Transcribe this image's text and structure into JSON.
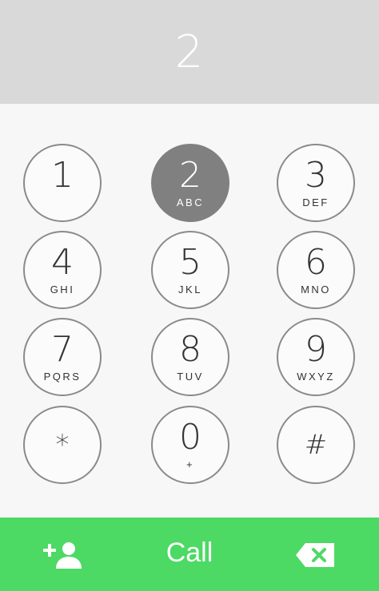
{
  "display": {
    "value": "2"
  },
  "keypad": {
    "keys": [
      {
        "digit": "1",
        "letters": ""
      },
      {
        "digit": "2",
        "letters": "ABC"
      },
      {
        "digit": "3",
        "letters": "DEF"
      },
      {
        "digit": "4",
        "letters": "GHI"
      },
      {
        "digit": "5",
        "letters": "JKL"
      },
      {
        "digit": "6",
        "letters": "MNO"
      },
      {
        "digit": "7",
        "letters": "PQRS"
      },
      {
        "digit": "8",
        "letters": "TUV"
      },
      {
        "digit": "9",
        "letters": "WXYZ"
      },
      {
        "digit": "*",
        "letters": ""
      },
      {
        "digit": "0",
        "letters": "+"
      },
      {
        "digit": "#",
        "letters": ""
      }
    ],
    "active_key": "2"
  },
  "bottom_bar": {
    "call_label": "Call",
    "add_contact_icon": "add-contact-icon",
    "backspace_icon": "backspace-icon"
  },
  "colors": {
    "display_bg": "#d9d9d9",
    "call_bar": "#4cd964",
    "active_key": "#808080"
  }
}
